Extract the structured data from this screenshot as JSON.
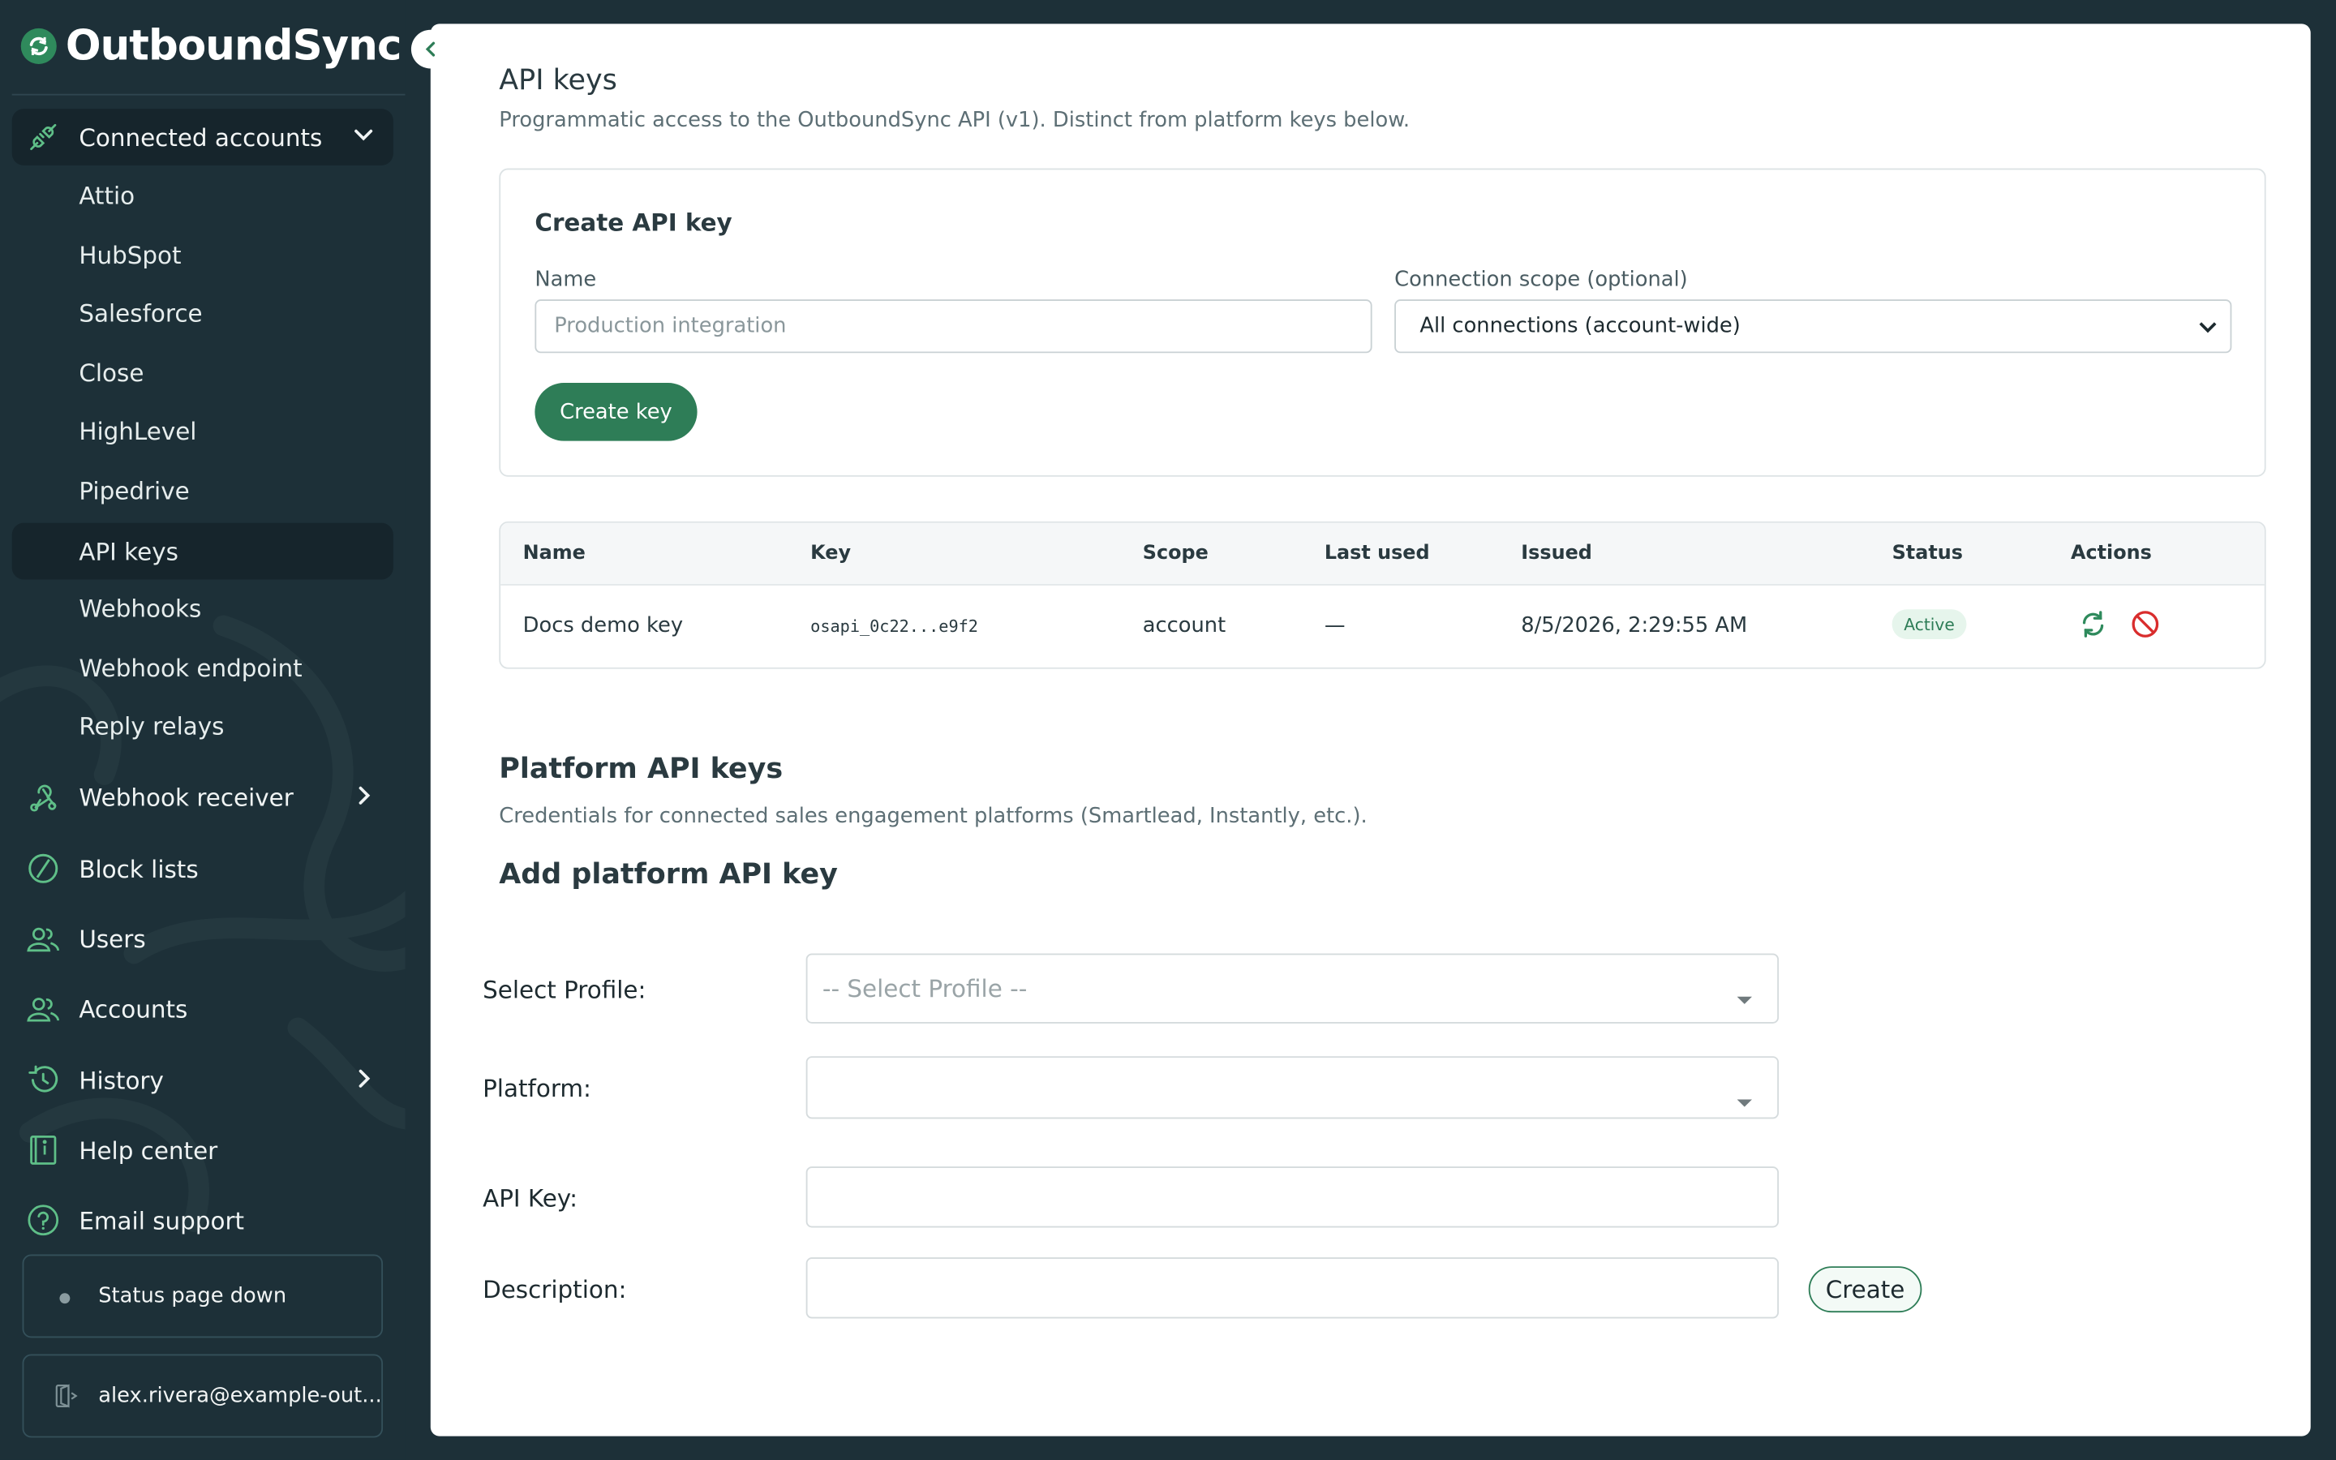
{
  "brand": {
    "name": "OutboundSync",
    "logo_icon": "sync-icon"
  },
  "sidebar": {
    "group": {
      "label": "Connected accounts",
      "icon": "plug-icon",
      "expanded": true
    },
    "sub_items": [
      {
        "label": "Attio",
        "active": false
      },
      {
        "label": "HubSpot",
        "active": false
      },
      {
        "label": "Salesforce",
        "active": false
      },
      {
        "label": "Close",
        "active": false
      },
      {
        "label": "HighLevel",
        "active": false
      },
      {
        "label": "Pipedrive",
        "active": false
      },
      {
        "label": "API keys",
        "active": true
      },
      {
        "label": "Webhooks",
        "active": false
      },
      {
        "label": "Webhook endpoint",
        "active": false
      },
      {
        "label": "Reply relays",
        "active": false
      }
    ],
    "items": [
      {
        "label": "Webhook receiver",
        "icon": "webhook-icon",
        "expandable": true
      },
      {
        "label": "Block lists",
        "icon": "block-icon",
        "expandable": false
      },
      {
        "label": "Users",
        "icon": "users-icon",
        "expandable": false
      },
      {
        "label": "Accounts",
        "icon": "accounts-icon",
        "expandable": false
      },
      {
        "label": "History",
        "icon": "history-icon",
        "expandable": true
      },
      {
        "label": "Help center",
        "icon": "book-icon",
        "expandable": false
      },
      {
        "label": "Email support",
        "icon": "help-icon",
        "expandable": false
      }
    ],
    "status": {
      "label": "Status page down"
    },
    "user": {
      "email": "alex.rivera@example-out..."
    }
  },
  "api_keys": {
    "title": "API keys",
    "subtitle": "Programmatic access to the OutboundSync API (v1). Distinct from platform keys below.",
    "create": {
      "title": "Create API key",
      "name_label": "Name",
      "name_placeholder": "Production integration",
      "scope_label": "Connection scope (optional)",
      "scope_value": "All connections (account-wide)",
      "button": "Create key"
    },
    "table": {
      "columns": [
        "Name",
        "Key",
        "Scope",
        "Last used",
        "Issued",
        "Status",
        "Actions"
      ],
      "rows": [
        {
          "name": "Docs demo key",
          "key": "osapi_0c22...e9f2",
          "scope": "account",
          "last_used": "—",
          "issued": "8/5/2026, 2:29:55 AM",
          "status": "Active"
        }
      ]
    }
  },
  "platform": {
    "title": "Platform API keys",
    "subtitle": "Credentials for connected sales engagement platforms (Smartlead, Instantly, etc.).",
    "add_title": "Add platform API key",
    "fields": {
      "profile_label": "Select Profile:",
      "profile_placeholder": "-- Select Profile --",
      "platform_label": "Platform:",
      "api_key_label": "API Key:",
      "description_label": "Description:"
    },
    "button": "Create"
  },
  "colors": {
    "sidebar_bg": "#1d3038",
    "accent": "#2e7d57",
    "active_badge_bg": "#e6f5ec"
  }
}
